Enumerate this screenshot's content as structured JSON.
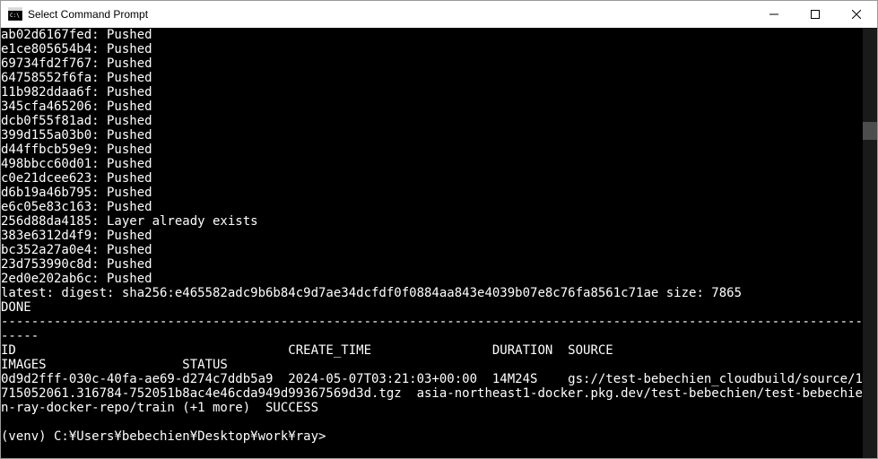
{
  "window": {
    "title": "Select Command Prompt"
  },
  "terminal": {
    "layers": [
      {
        "id": "ab02d6167fed",
        "status": "Pushed"
      },
      {
        "id": "e1ce805654b4",
        "status": "Pushed"
      },
      {
        "id": "69734fd2f767",
        "status": "Pushed"
      },
      {
        "id": "64758552f6fa",
        "status": "Pushed"
      },
      {
        "id": "11b982ddaa6f",
        "status": "Pushed"
      },
      {
        "id": "345cfa465206",
        "status": "Pushed"
      },
      {
        "id": "dcb0f55f81ad",
        "status": "Pushed"
      },
      {
        "id": "399d155a03b0",
        "status": "Pushed"
      },
      {
        "id": "d44ffbcb59e9",
        "status": "Pushed"
      },
      {
        "id": "498bbcc60d01",
        "status": "Pushed"
      },
      {
        "id": "c0e21dcee623",
        "status": "Pushed"
      },
      {
        "id": "d6b19a46b795",
        "status": "Pushed"
      },
      {
        "id": "e6c05e83c163",
        "status": "Pushed"
      },
      {
        "id": "256d88da4185",
        "status": "Layer already exists"
      },
      {
        "id": "383e6312d4f9",
        "status": "Pushed"
      },
      {
        "id": "bc352a27a0e4",
        "status": "Pushed"
      },
      {
        "id": "23d753990c8d",
        "status": "Pushed"
      },
      {
        "id": "2ed0e202ab6c",
        "status": "Pushed"
      }
    ],
    "digest_line": "latest: digest: sha256:e465582adc9b6b84c9d7ae34dcfdf0f0884aa843e4039b07e8c76fa8561c71ae size: 7865",
    "done": "DONE",
    "separator": "-----------------------------------------------------------------------------------------------------------------------",
    "table_header": "ID                                    CREATE_TIME                DURATION  SOURCE                                                  IMAGES                  STATUS",
    "table_row": "0d9d2fff-030c-40fa-ae69-d274c7ddb5a9  2024-05-07T03:21:03+00:00  14M24S    gs://test-bebechien_cloudbuild/source/1715052061.316784-752051b8ac4e46cda949d99367569d3d.tgz  asia-northeast1-docker.pkg.dev/test-bebechien/test-bebechien-ray-docker-repo/train (+1 more)  SUCCESS",
    "blank": "",
    "prompt": "(venv) C:¥Users¥bebechien¥Desktop¥work¥ray>"
  }
}
